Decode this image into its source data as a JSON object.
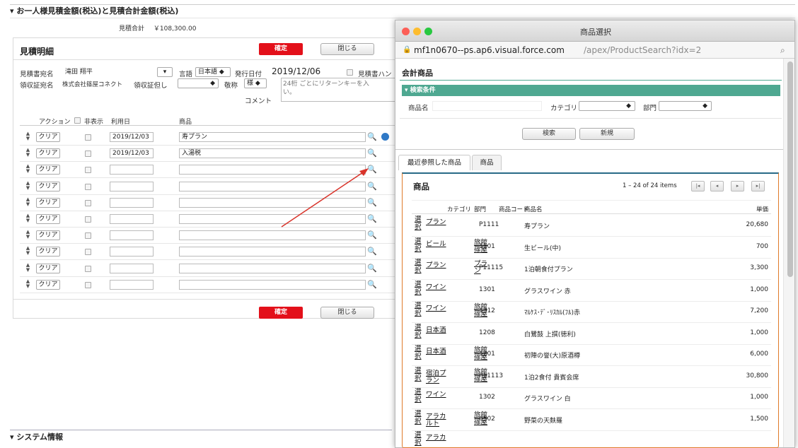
{
  "top_section": {
    "title": "▾ お一人様見積金額(税込)と見積合計金額(税込)",
    "total_label": "見積合計",
    "total_value": "￥108,300.00"
  },
  "form": {
    "title": "見積明細",
    "confirm": "確定",
    "close": "閉じる",
    "addressee_label": "見積書宛名",
    "addressee_value": "滝田 翔平",
    "language_label": "言語",
    "language_value": "日本語",
    "issue_label": "発行日付",
    "issue_value": "2019/12/06",
    "hanko_label": "見積書ハン",
    "receipt_label": "領収証宛名",
    "receipt_value": "株式会社篠屋コネクト",
    "receipt_note_label": "領収証但し",
    "honorific_label": "敬称",
    "honorific_value": "様",
    "comment_label": "コメント",
    "comment_value": "24桁 ごとにリターンキーを入\nい。",
    "columns": {
      "action": "アクション",
      "hidden": "非表示",
      "date": "利用日",
      "product": "商品"
    },
    "clear_label": "クリア",
    "rows": [
      {
        "date": "2019/12/03",
        "product": "寿プラン"
      },
      {
        "date": "2019/12/03",
        "product": "入湯税"
      },
      {
        "date": "",
        "product": ""
      },
      {
        "date": "",
        "product": ""
      },
      {
        "date": "",
        "product": ""
      },
      {
        "date": "",
        "product": ""
      },
      {
        "date": "",
        "product": ""
      },
      {
        "date": "",
        "product": ""
      },
      {
        "date": "",
        "product": ""
      },
      {
        "date": "",
        "product": ""
      }
    ]
  },
  "bottom_section": {
    "title": "▾ システム情報"
  },
  "popup": {
    "window_title": "商品選択",
    "url_host": "mf1n0670--ps.ap6.visual.force.com",
    "url_path": "/apex/ProductSearch?idx=2",
    "heading": "会計商品",
    "criteria_title": "▾ 検索条件",
    "name_label": "商品名",
    "category_label": "カテゴリ",
    "dept_label": "部門",
    "search_btn": "検索",
    "new_btn": "新規",
    "tabs": [
      "最近参照した商品",
      "商品"
    ],
    "list_title": "商品",
    "pager": "1 – 24 of 24 items",
    "columns": {
      "category": "カテゴリ",
      "dept": "部門",
      "code": "商品コード",
      "name": "商品名",
      "price": "単価"
    },
    "select_label": "選択",
    "items": [
      {
        "category": "プラン",
        "dept": "",
        "code": "P1111",
        "name": "寿プラン",
        "price": "20,680"
      },
      {
        "category": "ビール",
        "dept": "旅館篠屋",
        "code": "1101",
        "name": "生ビール(中)",
        "price": "700"
      },
      {
        "category": "プラン",
        "dept": "プラン",
        "code": "P11115",
        "name": "1泊朝食付プラン",
        "price": "3,300"
      },
      {
        "category": "ワイン",
        "dept": "",
        "code": "1301",
        "name": "グラスワイン 赤",
        "price": "1,000"
      },
      {
        "category": "ワイン",
        "dept": "旅館篠屋",
        "code": "1312",
        "name": "ﾏﾙｹｽ･ﾃﾞ･ﾘｽｶﾙ(ﾌﾙ)赤",
        "price": "7,200"
      },
      {
        "category": "日本酒",
        "dept": "",
        "code": "1208",
        "name": "白鷺鼓 上撰(徳利)",
        "price": "1,000"
      },
      {
        "category": "日本酒",
        "dept": "旅館篠屋",
        "code": "1201",
        "name": "初陣の誉(大)原酒樽",
        "price": "6,000"
      },
      {
        "category": "宿泊プラン",
        "dept": "旅館篠屋",
        "code": "P11113",
        "name": "1泊2食付 貴賓会席",
        "price": "30,800"
      },
      {
        "category": "ワイン",
        "dept": "",
        "code": "1302",
        "name": "グラスワイン 白",
        "price": "1,000"
      },
      {
        "category": "アラカルト",
        "dept": "旅館篠屋",
        "code": "0502",
        "name": "野菜の天麩羅",
        "price": "1,500"
      },
      {
        "category": "アラカ",
        "dept": "",
        "code": "",
        "name": "",
        "price": ""
      }
    ]
  },
  "colors": {
    "accent_red": "#e3101a",
    "teal": "#4ea891",
    "header_blue": "#286a87",
    "arrow": "#d9342b"
  }
}
